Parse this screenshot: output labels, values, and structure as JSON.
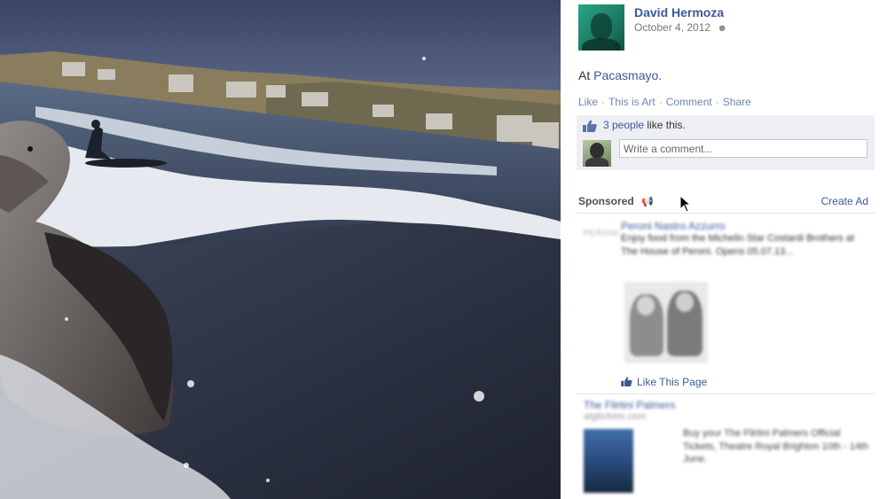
{
  "post": {
    "author": "David Hermoza",
    "date": "October 4, 2012",
    "location_prefix": "At",
    "location_name": "Pacasmayo.",
    "actions": [
      "Like",
      "This is Art",
      "Comment",
      "Share"
    ],
    "likes_count": "3 people",
    "likes_suffix": "like this.",
    "comment_placeholder": "Write a comment..."
  },
  "sidebar": {
    "sponsored_label": "Sponsored",
    "create_ad_label": "Create Ad",
    "ads": [
      {
        "logo": "PERONI",
        "title": "Peroni Nastro Azzurro",
        "body": "Enjoy food from the Michelin Star Costardi Brothers at The House of Peroni. Opens 05.07.13...",
        "like_label": "Like This Page"
      },
      {
        "title": "The Flirtini Palmers",
        "url": "atgtickets.com",
        "body": "Buy your The Flirtini Palmers Official Tickets, Theatre Royal Brighton 10th - 14th June."
      }
    ]
  },
  "colors": {
    "link": "#3b5998",
    "action_link": "#6d84b4",
    "like_box_bg": "#edeff4"
  },
  "icons": {
    "privacy": "friends-icon",
    "likes": "thumbs-up-icon",
    "sponsored": "megaphone-icon",
    "cursor": "mouse-pointer-icon"
  }
}
